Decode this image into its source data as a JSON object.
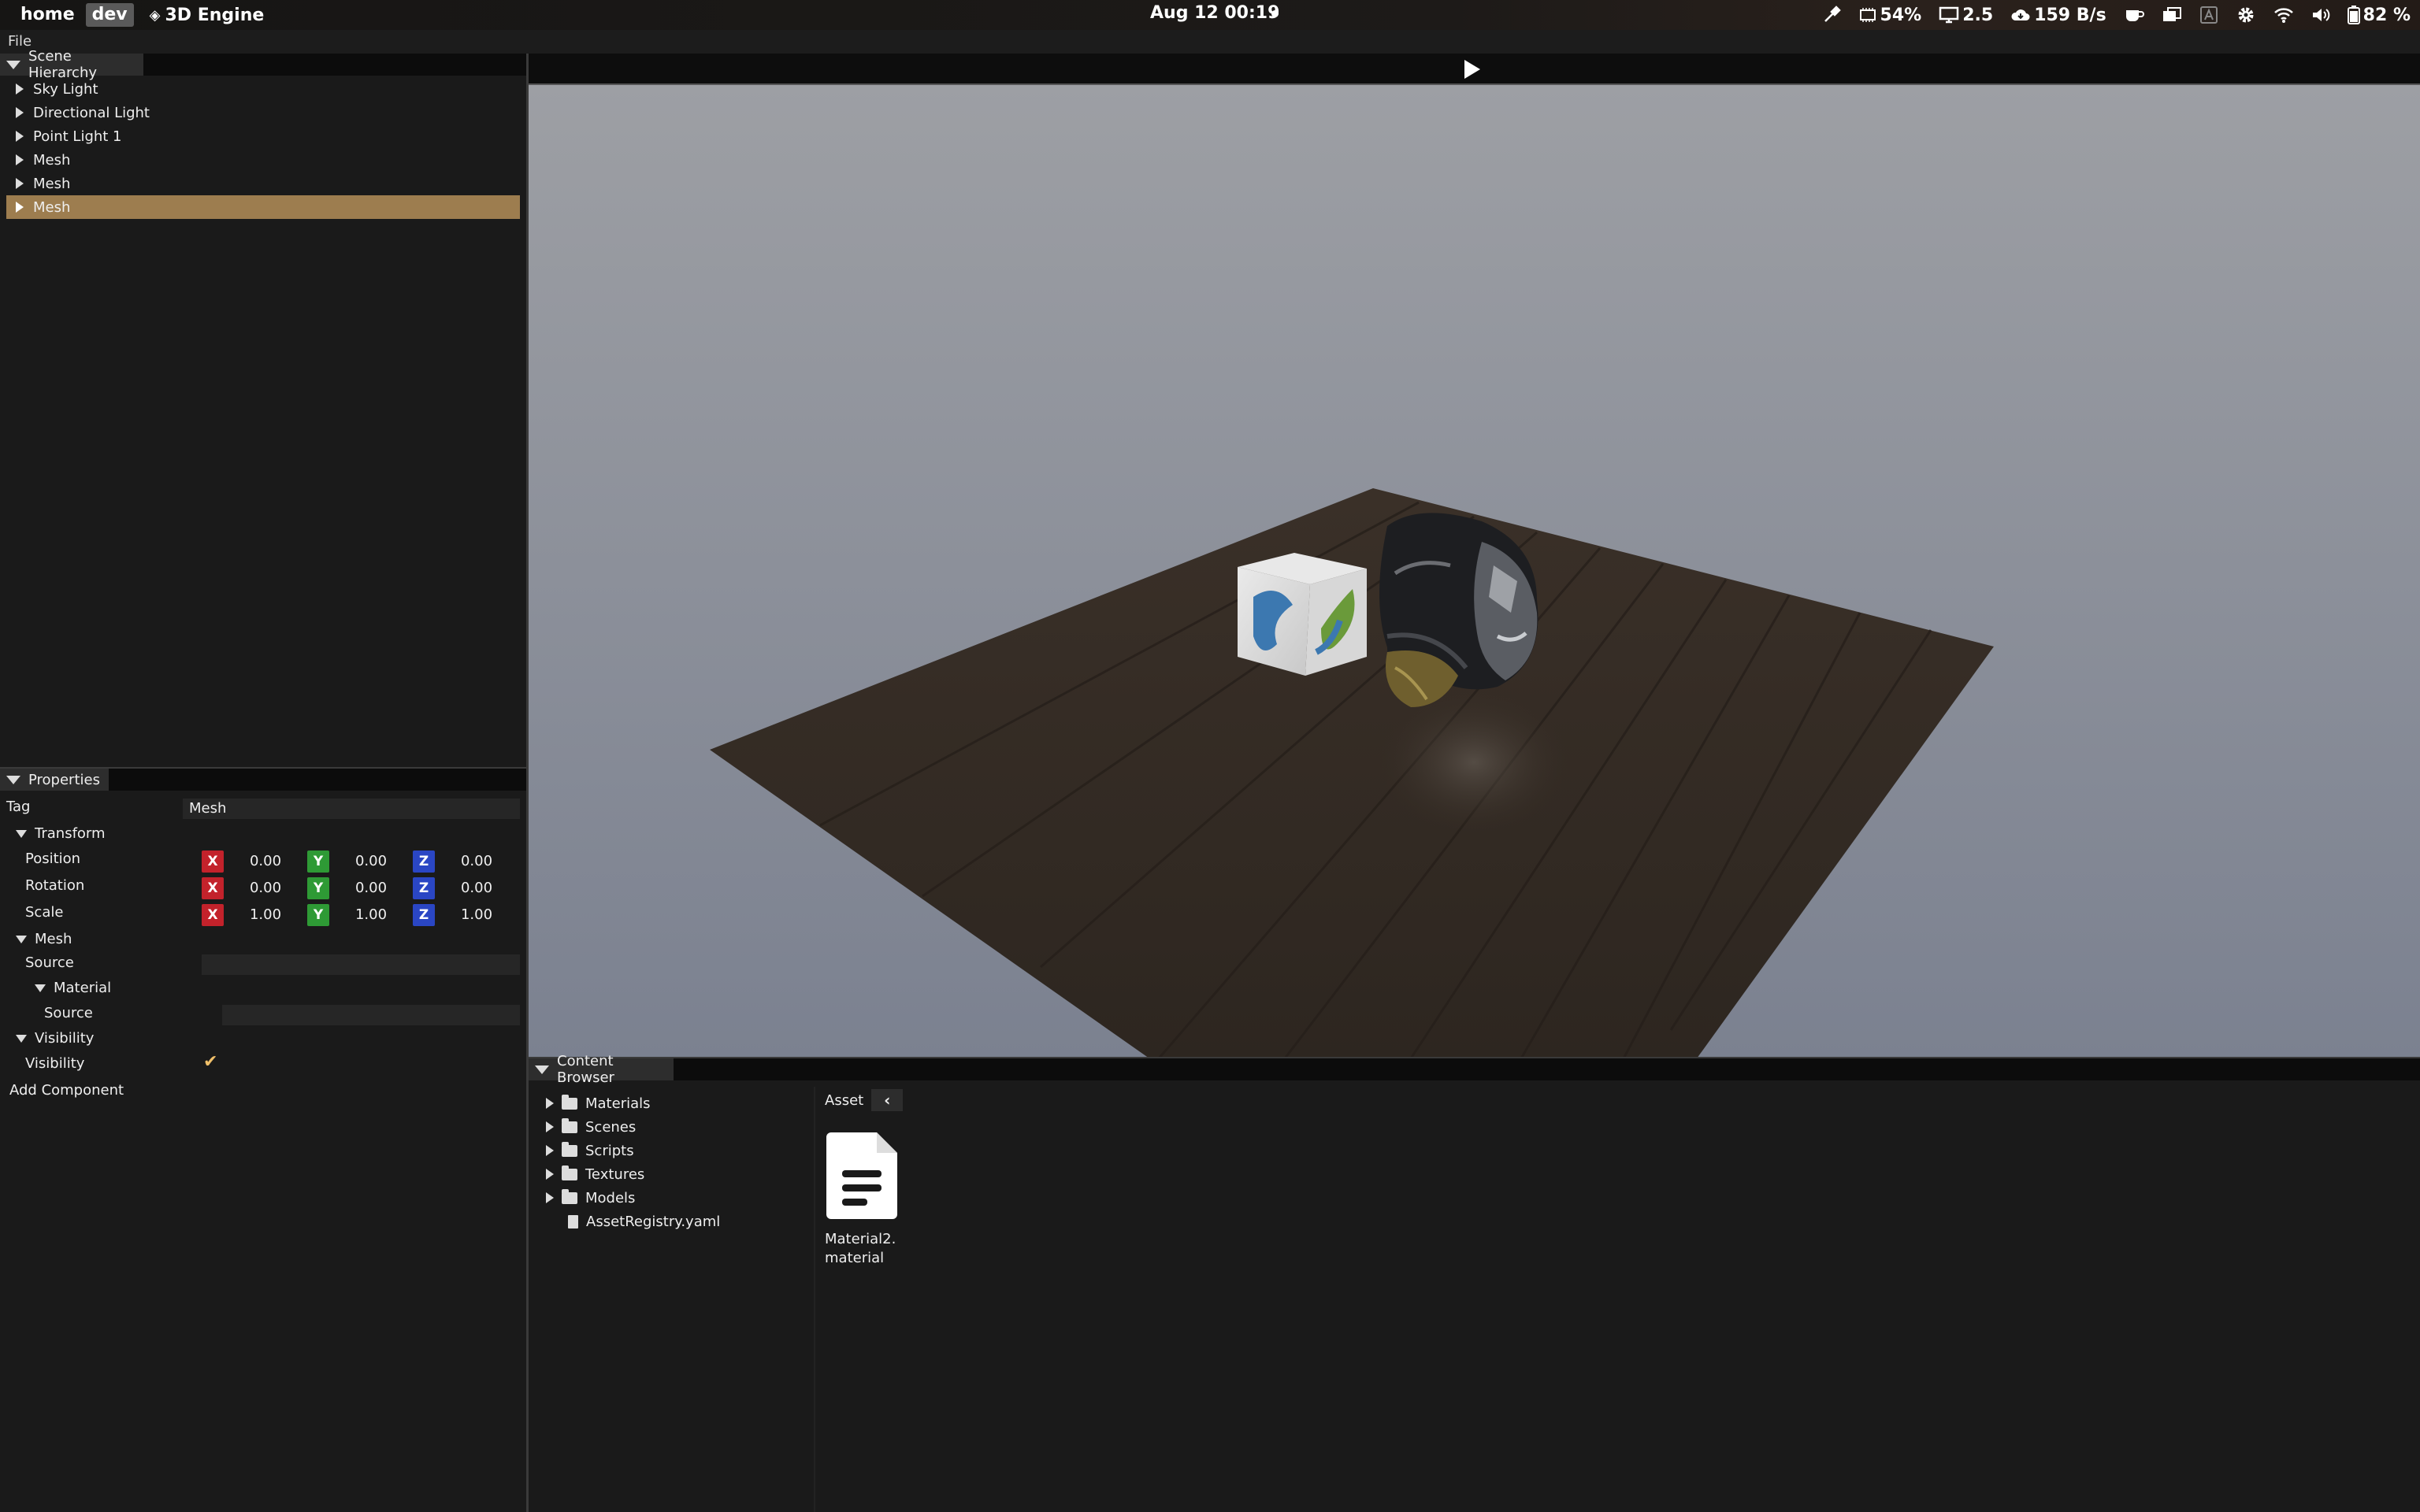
{
  "topbar": {
    "workspaces": [
      "home",
      "dev"
    ],
    "active_workspace": "dev",
    "app_title": "3D Engine",
    "clock": "Aug 12  00:19",
    "status": {
      "cpu": "54%",
      "load": "2.5",
      "network": "159 B/s",
      "battery": "82 %"
    }
  },
  "menubar": {
    "file": "File"
  },
  "hierarchy": {
    "title": "Scene Hierarchy",
    "items": [
      {
        "label": "Sky Light",
        "selected": false
      },
      {
        "label": "Directional Light",
        "selected": false
      },
      {
        "label": "Point Light 1",
        "selected": false
      },
      {
        "label": "Mesh",
        "selected": false
      },
      {
        "label": "Mesh",
        "selected": false
      },
      {
        "label": "Mesh",
        "selected": true
      }
    ]
  },
  "properties": {
    "title": "Properties",
    "tag_label": "Tag",
    "tag_value": "Mesh",
    "transform": {
      "header": "Transform",
      "axis_labels": [
        "X",
        "Y",
        "Z"
      ],
      "rows": [
        {
          "label": "Position",
          "values": [
            "0.00",
            "0.00",
            "0.00"
          ]
        },
        {
          "label": "Rotation",
          "values": [
            "0.00",
            "0.00",
            "0.00"
          ]
        },
        {
          "label": "Scale",
          "values": [
            "1.00",
            "1.00",
            "1.00"
          ]
        }
      ]
    },
    "mesh": {
      "header": "Mesh",
      "source_label": "Source",
      "source_value": ""
    },
    "material": {
      "header": "Material",
      "source_label": "Source",
      "source_value": ""
    },
    "visibility": {
      "header": "Visibility",
      "label": "Visibility",
      "checked": true,
      "check_glyph": "✔"
    },
    "add_component": "Add Component"
  },
  "content_browser": {
    "title": "Content Browser",
    "tree": [
      {
        "label": "Materials",
        "type": "folder"
      },
      {
        "label": "Scenes",
        "type": "folder"
      },
      {
        "label": "Scripts",
        "type": "folder"
      },
      {
        "label": "Textures",
        "type": "folder"
      },
      {
        "label": "Models",
        "type": "folder"
      },
      {
        "label": "AssetRegistry.yaml",
        "type": "file"
      }
    ],
    "path": "Asset",
    "back_glyph": "‹",
    "assets": [
      {
        "name": "Material2.\nmaterial",
        "icon": "document-icon"
      }
    ]
  },
  "colors": {
    "selection": "#9d7d4f",
    "axis_x": "#c3222b",
    "axis_y": "#2e9a35",
    "axis_z": "#2a46c4",
    "checkmark": "#f0c06a"
  }
}
